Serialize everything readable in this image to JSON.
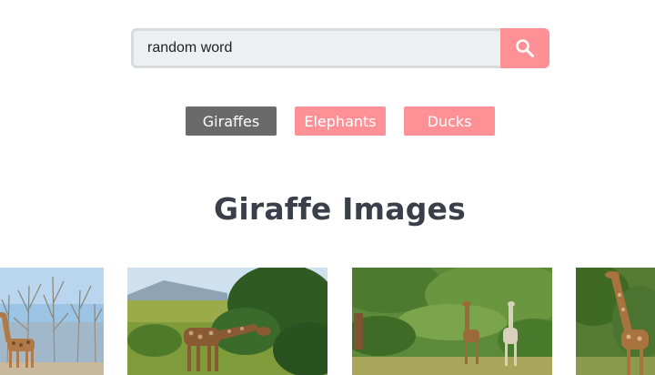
{
  "search": {
    "value": "random word",
    "icon": "search-icon"
  },
  "categories": [
    {
      "label": "Giraffes",
      "active": true
    },
    {
      "label": "Elephants",
      "active": false
    },
    {
      "label": "Ducks",
      "active": false
    }
  ],
  "section_title": "Giraffe Images",
  "gallery": [
    {
      "subject": "giraffe among bare trees"
    },
    {
      "subject": "giraffe grazing by bushes"
    },
    {
      "subject": "two giraffes in green savanna"
    },
    {
      "subject": "giraffe near trees"
    }
  ],
  "colors": {
    "accent": "#ff9196",
    "active_tab": "#6a6a6a",
    "heading": "#3a4049",
    "input_bg": "#eeeff1"
  }
}
